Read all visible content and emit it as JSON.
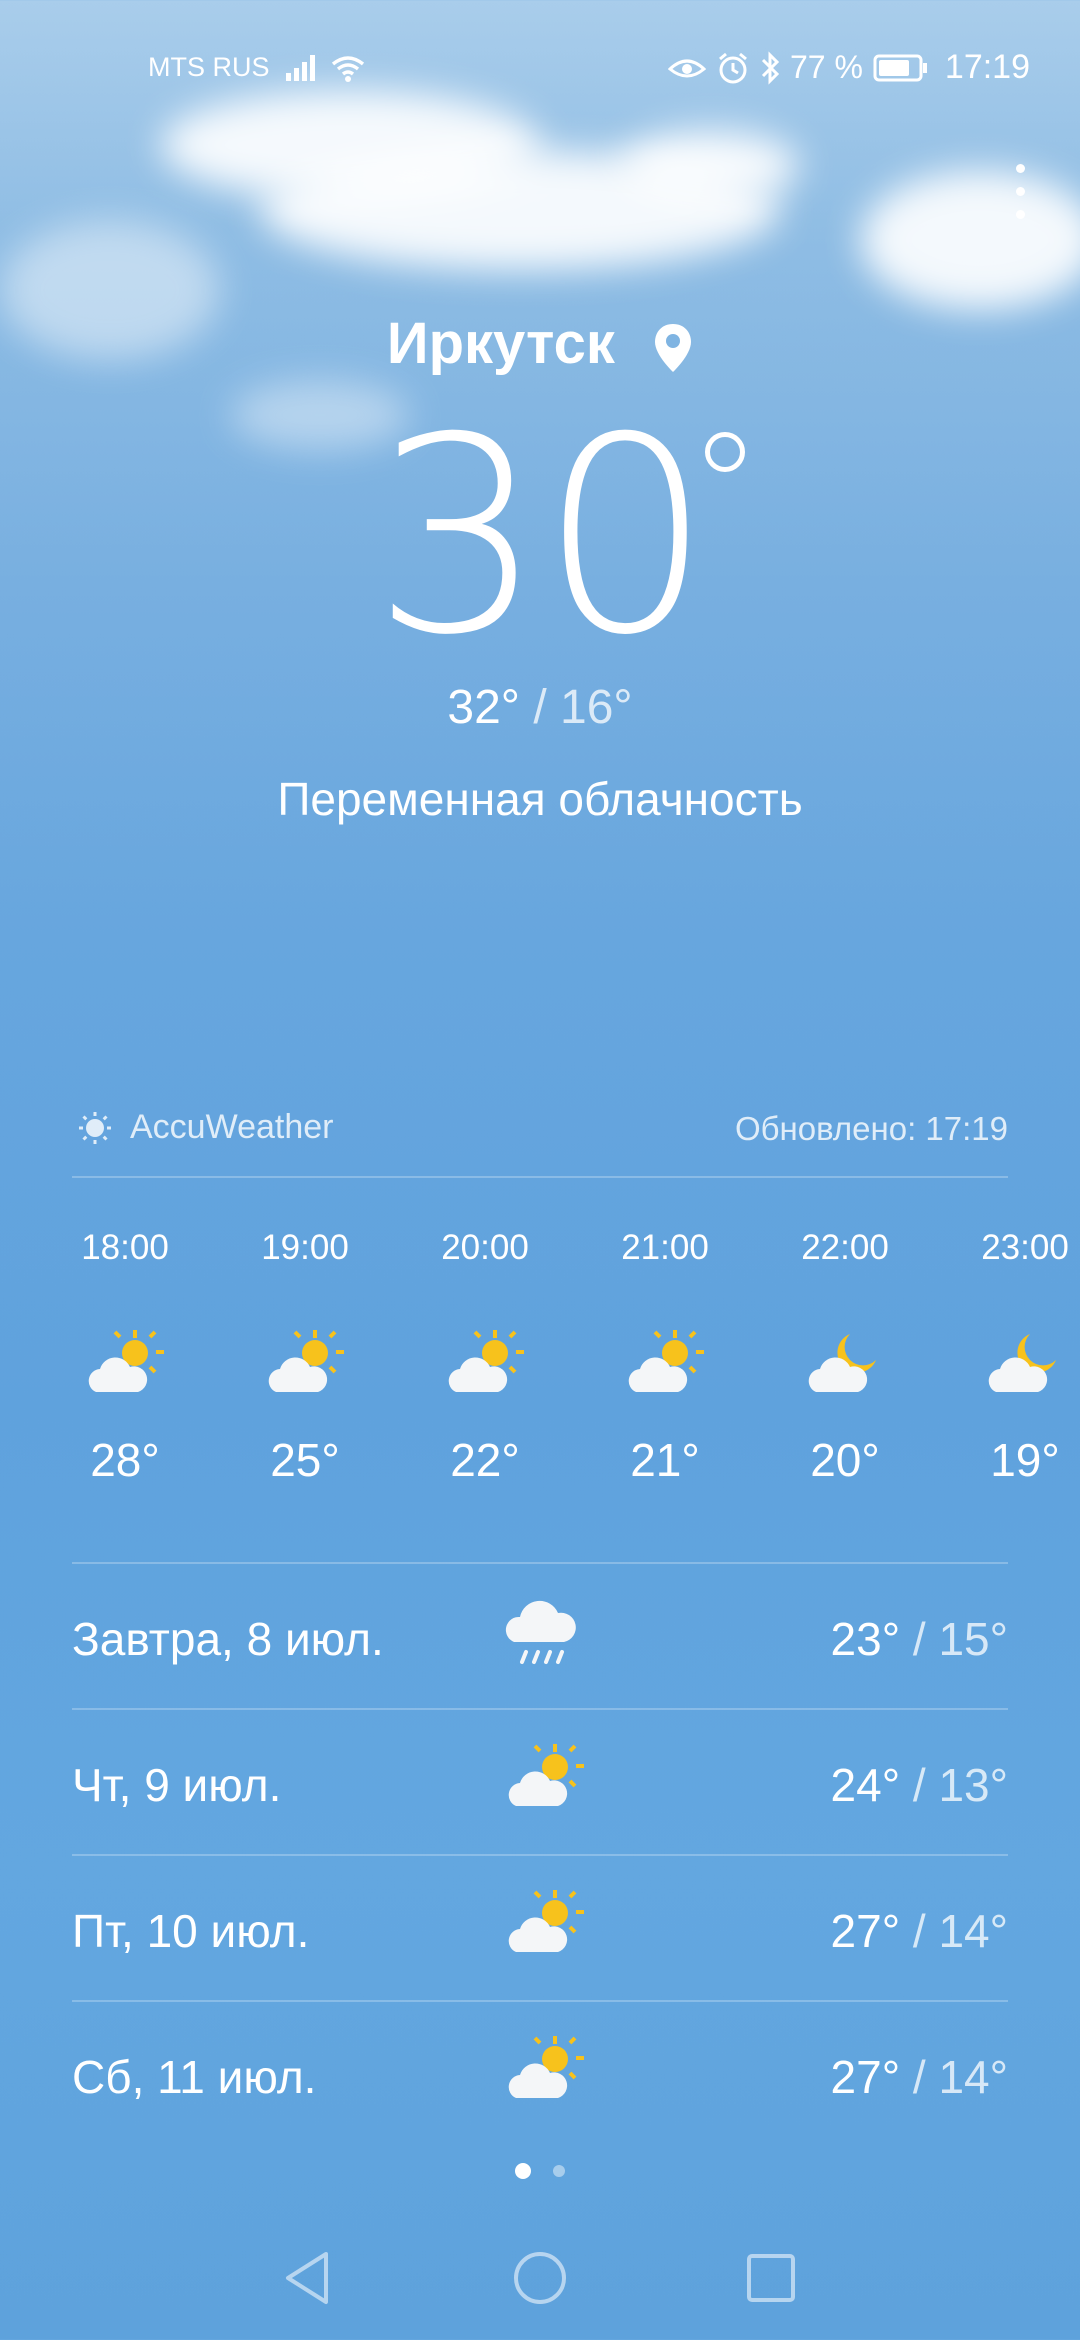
{
  "status_bar": {
    "carrier": "MTS RUS",
    "battery": "77 %",
    "time": "17:19",
    "icons": [
      "signal-icon",
      "wifi-icon",
      "eye-comfort-icon",
      "alarm-icon",
      "bluetooth-icon",
      "battery-icon"
    ]
  },
  "location": {
    "city": "Иркутск",
    "icon": "location-pin-icon"
  },
  "current": {
    "temperature": "30",
    "high": "32°",
    "separator": "/",
    "low": "16°",
    "condition": "Переменная облачность"
  },
  "source": {
    "provider": "AccuWeather",
    "updated": "Обновлено: 17:19"
  },
  "hourly": [
    {
      "time": "18:00",
      "icon": "partly-sunny-icon",
      "temp": "28°"
    },
    {
      "time": "19:00",
      "icon": "partly-sunny-icon",
      "temp": "25°"
    },
    {
      "time": "20:00",
      "icon": "partly-sunny-icon",
      "temp": "22°"
    },
    {
      "time": "21:00",
      "icon": "partly-sunny-icon",
      "temp": "21°"
    },
    {
      "time": "22:00",
      "icon": "partly-cloudy-night-icon",
      "temp": "20°"
    },
    {
      "time": "23:00",
      "icon": "partly-cloudy-night-icon",
      "temp": "19°"
    }
  ],
  "daily": [
    {
      "label": "Завтра, 8 июл.",
      "icon": "rain-icon",
      "high": "23°",
      "low": "15°"
    },
    {
      "label": "Чт, 9 июл.",
      "icon": "partly-sunny-icon",
      "high": "24°",
      "low": "13°"
    },
    {
      "label": "Пт, 10 июл.",
      "icon": "partly-sunny-icon",
      "high": "27°",
      "low": "14°"
    },
    {
      "label": "Сб, 11 июл.",
      "icon": "partly-sunny-icon",
      "high": "27°",
      "low": "14°"
    }
  ],
  "pager": {
    "pages": 2,
    "active": 1
  },
  "colors": {
    "sun": "#f7c21c",
    "text": "#ffffff"
  }
}
